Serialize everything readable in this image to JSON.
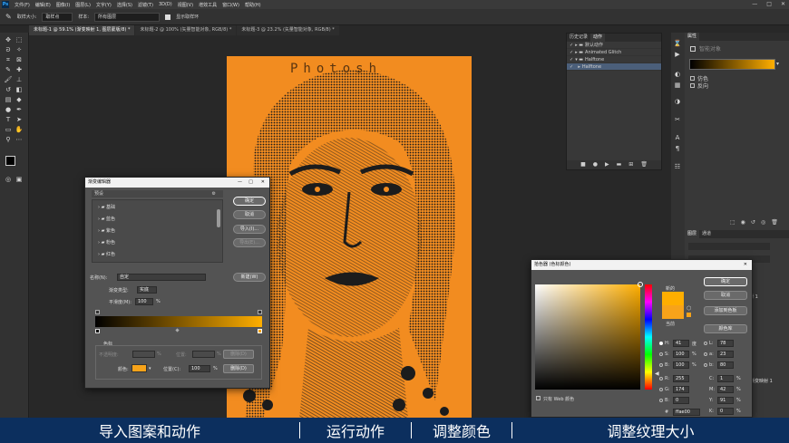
{
  "menubar": {
    "app_icon": "Ps",
    "items": [
      "文件(F)",
      "编辑(E)",
      "图像(I)",
      "图层(L)",
      "文字(Y)",
      "选择(S)",
      "滤镜(T)",
      "3D(D)",
      "视图(V)",
      "增效工具",
      "窗口(W)",
      "帮助(H)"
    ]
  },
  "optbar": {
    "sample_size_label": "取样大小:",
    "sample_size_value": "取样点",
    "sample_label": "样本:",
    "sample_value": "所有图层",
    "show_ring_label": "显示取样环"
  },
  "tabs": [
    "未标题-1 @ 59.1% (渐变映射 1, 图层蒙版/8) *",
    "未标题-2 @ 100% (矢量智能对象, RGB/8) *",
    "未标题-3 @ 23.2% (矢量智能对象, RGB/8) *"
  ],
  "canvas": {
    "watermark": "Photosh",
    "colors": {
      "orange": "#f28c20",
      "dark": "#1c1c1c"
    }
  },
  "actions_panel": {
    "tabs": [
      "历史记录",
      "动作"
    ],
    "rows": [
      "默认动作",
      "Animated Glitch",
      "Halftone",
      "Halftone"
    ]
  },
  "props_panel": {
    "header": "属性",
    "smart_object_label": "智能对象",
    "dither_label": "仿色",
    "reverse_label": "反向"
  },
  "layers_panel": {
    "tabs": [
      "图层",
      "通道"
    ],
    "row_label": "映射 1",
    "row2_label": "渐变映射 1"
  },
  "gradient_editor": {
    "title": "渐变编辑器",
    "presets_label": "预设",
    "folders": [
      "基础",
      "蓝色",
      "紫色",
      "粉色",
      "红色"
    ],
    "ok": "确定",
    "cancel": "取消",
    "import": "导入(I)...",
    "export": "导出(E)...",
    "name_label": "名称(N):",
    "name_value": "自定",
    "new_button": "新建(W)",
    "type_label": "渐变类型:",
    "type_value": "实底",
    "smooth_label": "平滑度(M):",
    "smooth_value": "100",
    "smooth_unit": "%",
    "stops_label": "色标",
    "opacity_label": "不透明度:",
    "location_label1": "位置:",
    "delete_label1": "删除(D)",
    "color_label": "颜色:",
    "location_label2": "位置(C):",
    "location_value": "100",
    "pct": "%",
    "delete_label2": "删除(D)"
  },
  "color_picker": {
    "title": "拾色器 (色标颜色)",
    "ok": "确定",
    "cancel": "取消",
    "add_swatch": "添加到色板",
    "libraries": "颜色库",
    "new_label": "新的",
    "current_label": "当前",
    "only_web": "只有 Web 颜色",
    "fields": [
      {
        "k": "H:",
        "v": "41",
        "u": "度"
      },
      {
        "k": "S:",
        "v": "100",
        "u": "%"
      },
      {
        "k": "B:",
        "v": "100",
        "u": "%"
      },
      {
        "k": "R:",
        "v": "255",
        "u": ""
      },
      {
        "k": "G:",
        "v": "174",
        "u": ""
      },
      {
        "k": "B:",
        "v": "0",
        "u": ""
      }
    ],
    "lab": [
      {
        "k": "L:",
        "v": "78"
      },
      {
        "k": "a:",
        "v": "23"
      },
      {
        "k": "b:",
        "v": "80"
      }
    ],
    "cmyk": [
      {
        "k": "C:",
        "v": "1",
        "u": "%"
      },
      {
        "k": "M:",
        "v": "42",
        "u": "%"
      },
      {
        "k": "Y:",
        "v": "91",
        "u": "%"
      },
      {
        "k": "K:",
        "v": "0",
        "u": "%"
      }
    ],
    "hex_prefix": "#",
    "hex": "ffae00",
    "new_color": "#ffae00",
    "current_color": "#f7a31a"
  },
  "bottom_bar": {
    "items": [
      "导入图案和动作",
      "运行动作",
      "调整颜色",
      "调整纹理大小"
    ]
  }
}
